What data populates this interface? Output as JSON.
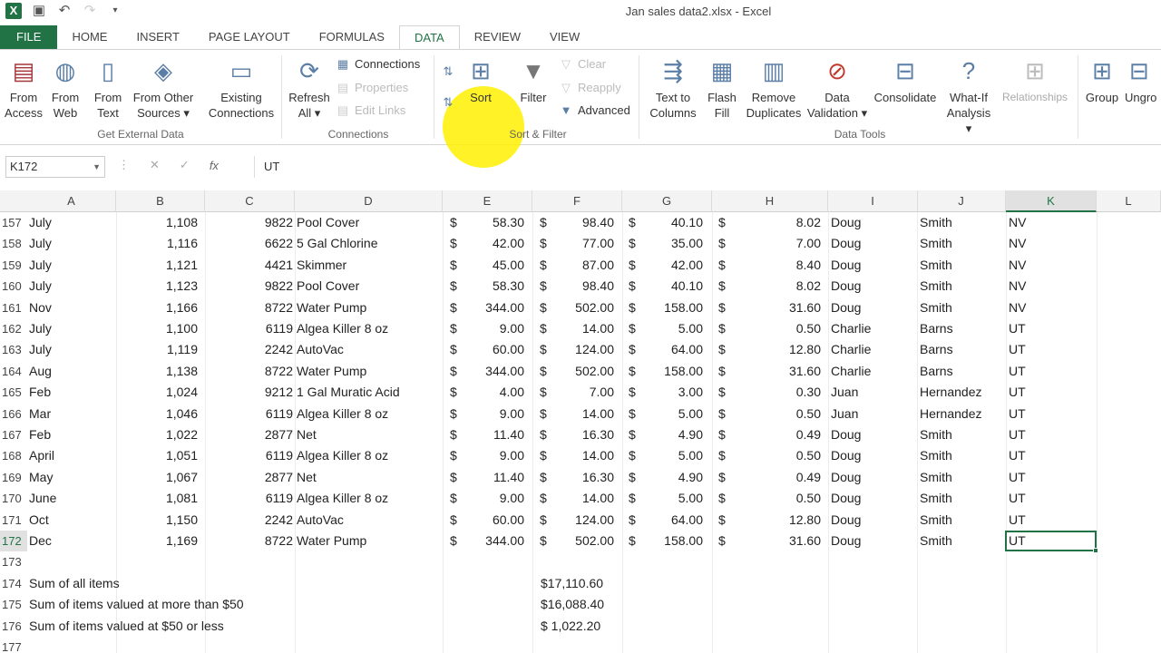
{
  "window": {
    "title": "Jan sales data2.xlsx - Excel"
  },
  "tabs": [
    "FILE",
    "HOME",
    "INSERT",
    "PAGE LAYOUT",
    "FORMULAS",
    "DATA",
    "REVIEW",
    "VIEW"
  ],
  "ribbon": {
    "get_external": {
      "from_access": [
        "From",
        "Access"
      ],
      "from_web": [
        "From",
        "Web"
      ],
      "from_text": [
        "From",
        "Text"
      ],
      "from_other": [
        "From Other",
        "Sources ▾"
      ],
      "existing": [
        "Existing",
        "Connections"
      ],
      "label": "Get External Data"
    },
    "connections": {
      "refresh": [
        "Refresh",
        "All ▾"
      ],
      "connections": "Connections",
      "properties": "Properties",
      "edit_links": "Edit Links",
      "label": "Connections"
    },
    "sort_filter": {
      "sort": "Sort",
      "filter": "Filter",
      "clear": "Clear",
      "reapply": "Reapply",
      "advanced": "Advanced",
      "label": "Sort & Filter"
    },
    "data_tools": {
      "text_to_columns": [
        "Text to",
        "Columns"
      ],
      "flash_fill": [
        "Flash",
        "Fill"
      ],
      "remove_duplicates": [
        "Remove",
        "Duplicates"
      ],
      "data_validation": [
        "Data",
        "Validation ▾"
      ],
      "consolidate": "Consolidate",
      "what_if": [
        "What-If",
        "Analysis ▾"
      ],
      "relationships": "Relationships",
      "label": "Data Tools"
    },
    "outline": {
      "group": "Group",
      "ungroup": "Ungro"
    }
  },
  "formula_bar": {
    "name_box": "K172",
    "value": "UT"
  },
  "columns": [
    "A",
    "B",
    "C",
    "D",
    "E",
    "F",
    "G",
    "H",
    "I",
    "J",
    "K",
    "L"
  ],
  "rows": [
    {
      "n": "157",
      "a": "July",
      "b": "1,108",
      "c": "9822",
      "d": "Pool Cover",
      "e": "58.30",
      "f": "98.40",
      "g": "40.10",
      "h": "8.02",
      "i": "Doug",
      "j": "Smith",
      "k": "NV"
    },
    {
      "n": "158",
      "a": "July",
      "b": "1,116",
      "c": "6622",
      "d": "5 Gal Chlorine",
      "e": "42.00",
      "f": "77.00",
      "g": "35.00",
      "h": "7.00",
      "i": "Doug",
      "j": "Smith",
      "k": "NV"
    },
    {
      "n": "159",
      "a": "July",
      "b": "1,121",
      "c": "4421",
      "d": "Skimmer",
      "e": "45.00",
      "f": "87.00",
      "g": "42.00",
      "h": "8.40",
      "i": "Doug",
      "j": "Smith",
      "k": "NV"
    },
    {
      "n": "160",
      "a": "July",
      "b": "1,123",
      "c": "9822",
      "d": "Pool Cover",
      "e": "58.30",
      "f": "98.40",
      "g": "40.10",
      "h": "8.02",
      "i": "Doug",
      "j": "Smith",
      "k": "NV"
    },
    {
      "n": "161",
      "a": "Nov",
      "b": "1,166",
      "c": "8722",
      "d": "Water Pump",
      "e": "344.00",
      "f": "502.00",
      "g": "158.00",
      "h": "31.60",
      "i": "Doug",
      "j": "Smith",
      "k": "NV"
    },
    {
      "n": "162",
      "a": "July",
      "b": "1,100",
      "c": "6119",
      "d": "Algea Killer 8 oz",
      "e": "9.00",
      "f": "14.00",
      "g": "5.00",
      "h": "0.50",
      "i": "Charlie",
      "j": "Barns",
      "k": "UT"
    },
    {
      "n": "163",
      "a": "July",
      "b": "1,119",
      "c": "2242",
      "d": "AutoVac",
      "e": "60.00",
      "f": "124.00",
      "g": "64.00",
      "h": "12.80",
      "i": "Charlie",
      "j": "Barns",
      "k": "UT"
    },
    {
      "n": "164",
      "a": "Aug",
      "b": "1,138",
      "c": "8722",
      "d": "Water Pump",
      "e": "344.00",
      "f": "502.00",
      "g": "158.00",
      "h": "31.60",
      "i": "Charlie",
      "j": "Barns",
      "k": "UT"
    },
    {
      "n": "165",
      "a": "Feb",
      "b": "1,024",
      "c": "9212",
      "d": "1 Gal Muratic Acid",
      "e": "4.00",
      "f": "7.00",
      "g": "3.00",
      "h": "0.30",
      "i": "Juan",
      "j": "Hernandez",
      "k": "UT"
    },
    {
      "n": "166",
      "a": "Mar",
      "b": "1,046",
      "c": "6119",
      "d": "Algea Killer 8 oz",
      "e": "9.00",
      "f": "14.00",
      "g": "5.00",
      "h": "0.50",
      "i": "Juan",
      "j": "Hernandez",
      "k": "UT"
    },
    {
      "n": "167",
      "a": "Feb",
      "b": "1,022",
      "c": "2877",
      "d": "Net",
      "e": "11.40",
      "f": "16.30",
      "g": "4.90",
      "h": "0.49",
      "i": "Doug",
      "j": "Smith",
      "k": "UT"
    },
    {
      "n": "168",
      "a": "April",
      "b": "1,051",
      "c": "6119",
      "d": "Algea Killer 8 oz",
      "e": "9.00",
      "f": "14.00",
      "g": "5.00",
      "h": "0.50",
      "i": "Doug",
      "j": "Smith",
      "k": "UT"
    },
    {
      "n": "169",
      "a": "May",
      "b": "1,067",
      "c": "2877",
      "d": "Net",
      "e": "11.40",
      "f": "16.30",
      "g": "4.90",
      "h": "0.49",
      "i": "Doug",
      "j": "Smith",
      "k": "UT"
    },
    {
      "n": "170",
      "a": "June",
      "b": "1,081",
      "c": "6119",
      "d": "Algea Killer 8 oz",
      "e": "9.00",
      "f": "14.00",
      "g": "5.00",
      "h": "0.50",
      "i": "Doug",
      "j": "Smith",
      "k": "UT"
    },
    {
      "n": "171",
      "a": "Oct",
      "b": "1,150",
      "c": "2242",
      "d": "AutoVac",
      "e": "60.00",
      "f": "124.00",
      "g": "64.00",
      "h": "12.80",
      "i": "Doug",
      "j": "Smith",
      "k": "UT"
    },
    {
      "n": "172",
      "a": "Dec",
      "b": "1,169",
      "c": "8722",
      "d": "Water Pump",
      "e": "344.00",
      "f": "502.00",
      "g": "158.00",
      "h": "31.60",
      "i": "Doug",
      "j": "Smith",
      "k": "UT"
    }
  ],
  "currency": "$",
  "summary": [
    {
      "n": "173",
      "label": "",
      "value": ""
    },
    {
      "n": "174",
      "label": "Sum of all items",
      "value": "$17,110.60"
    },
    {
      "n": "175",
      "label": "Sum of items valued at more than $50",
      "value": "$16,088.40"
    },
    {
      "n": "176",
      "label": "Sum of items valued at $50 or less",
      "value": "$  1,022.20"
    },
    {
      "n": "177",
      "label": "",
      "value": ""
    }
  ]
}
